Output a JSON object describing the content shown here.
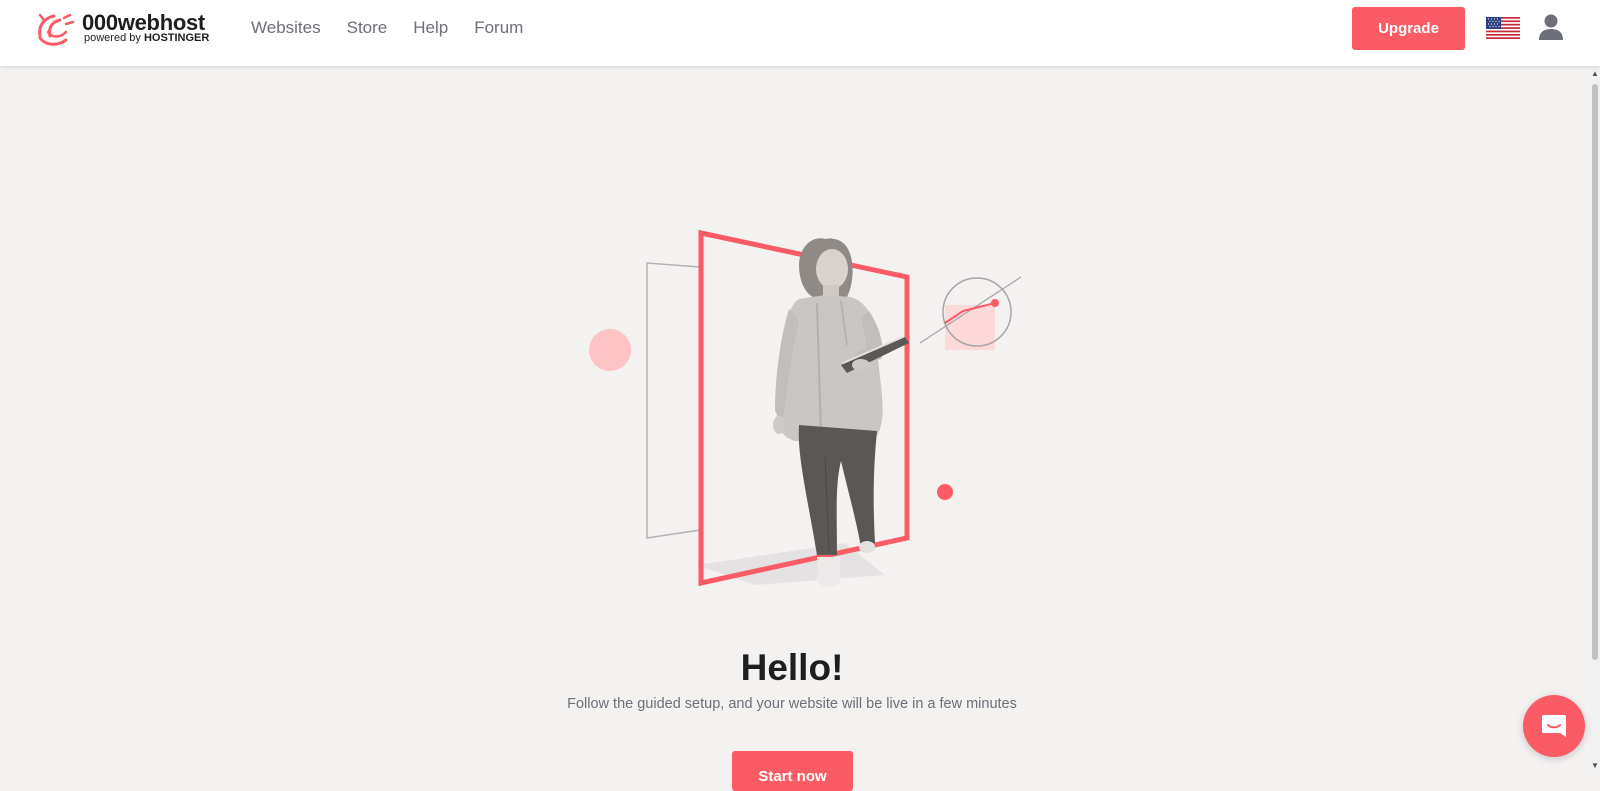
{
  "header": {
    "brand": {
      "name": "000webhost",
      "sub_prefix": "powered by",
      "sub_brand": "HOSTINGER"
    },
    "nav": [
      {
        "label": "Websites"
      },
      {
        "label": "Store"
      },
      {
        "label": "Help"
      },
      {
        "label": "Forum"
      }
    ],
    "upgrade_label": "Upgrade",
    "language_icon": "us-flag-icon",
    "account_icon": "user-icon"
  },
  "hero": {
    "title": "Hello!",
    "subtitle": "Follow the guided setup, and your website will be live in a few minutes",
    "cta_label": "Start now"
  },
  "chat": {
    "icon": "chat-icon"
  },
  "colors": {
    "accent": "#fa5b64",
    "accent_light": "#ffc2c5",
    "background": "#f4f1f1",
    "text_dark": "#1d1e20",
    "text_muted": "#6d6f79"
  }
}
